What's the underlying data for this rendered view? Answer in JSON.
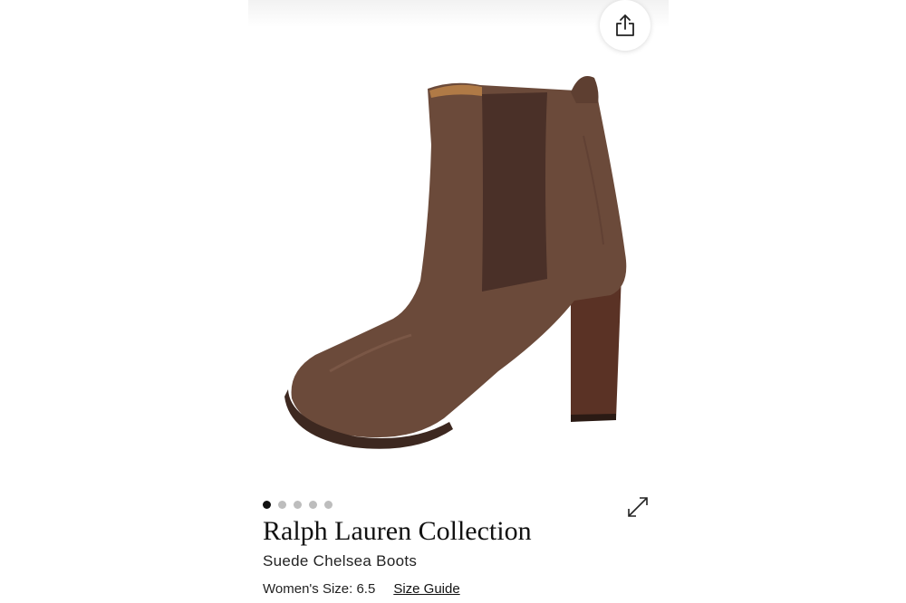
{
  "product": {
    "brand": "Ralph Lauren Collection",
    "name": "Suede Chelsea Boots",
    "size_label": "Women's Size: 6.5",
    "size_guide_label": "Size Guide"
  },
  "gallery": {
    "image_count": 5,
    "active_index": 0,
    "image_subject": "boot-image"
  },
  "icons": {
    "share": "share-icon",
    "expand": "expand-icon"
  },
  "colors": {
    "suede": "#6b4a3a",
    "elastic": "#4a3028",
    "heel": "#5a3225",
    "active_dot": "#111111",
    "inactive_dot": "#bdbdbd"
  }
}
